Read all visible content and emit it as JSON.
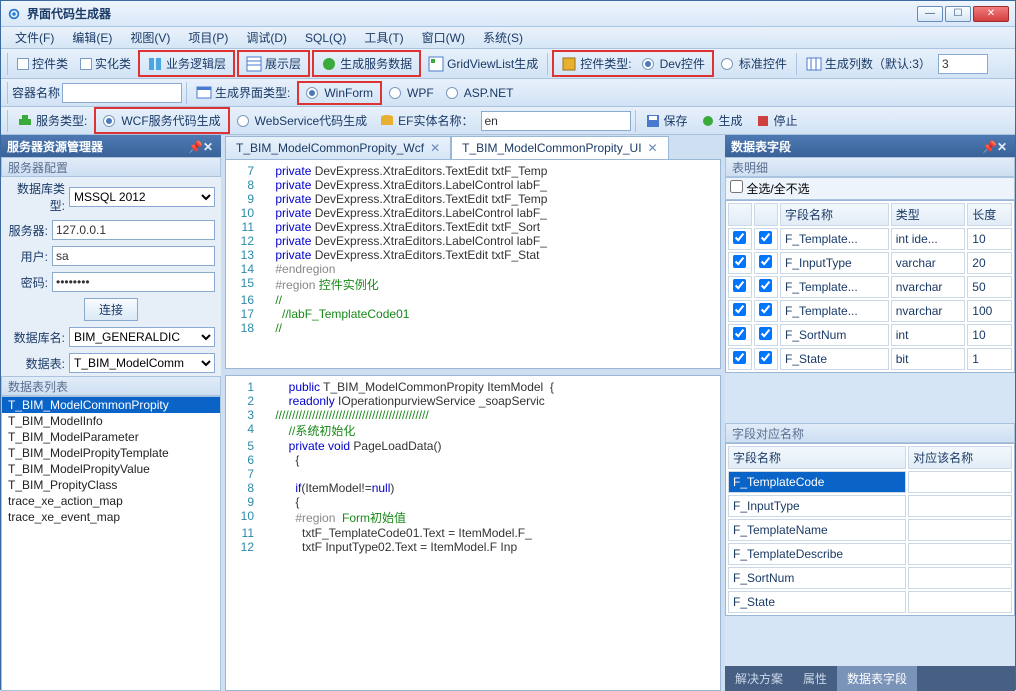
{
  "window": {
    "title": "界面代码生成器"
  },
  "menu": [
    "文件(F)",
    "编辑(E)",
    "视图(V)",
    "项目(P)",
    "调试(D)",
    "SQL(Q)",
    "工具(T)",
    "窗口(W)",
    "系统(S)"
  ],
  "toolbar1": {
    "ctrl_class": "控件类",
    "impl_class": "实化类",
    "biz_layer": "业务逻辑层",
    "view_layer": "展示层",
    "gen_data": "生成服务数据",
    "gridview": "GridViewList生成",
    "ctrl_type_lbl": "控件类型:",
    "dev_ctrl": "Dev控件",
    "std_ctrl": "标准控件",
    "gen_cols_lbl": "生成列数（默认:3）",
    "gen_cols_val": "3"
  },
  "toolbar2": {
    "container_lbl": "容器名称",
    "container_val": "",
    "gen_ui_type_lbl": "生成界面类型:",
    "winform": "WinForm",
    "wpf": "WPF",
    "aspnet": "ASP.NET"
  },
  "toolbar3": {
    "svc_type_lbl": "服务类型:",
    "wcf": "WCF服务代码生成",
    "webservice": "WebService代码生成",
    "ef_entity_lbl": "EF实体名称：",
    "ef_entity_val": "en",
    "save": "保存",
    "gen": "生成",
    "stop": "停止"
  },
  "left": {
    "title": "服务器资源管理器",
    "cfg_cap": "服务器配置",
    "db_type_lbl": "数据库类型:",
    "db_type_val": "MSSQL 2012",
    "server_lbl": "服务器:",
    "server_val": "127.0.0.1",
    "user_lbl": "用户:",
    "user_val": "sa",
    "pwd_lbl": "密码:",
    "pwd_val": "••••••••",
    "connect": "连接",
    "db_name_lbl": "数据库名:",
    "db_name_val": "BIM_GENERALDIC",
    "tbl_lbl": "数据表:",
    "tbl_val": "T_BIM_ModelComm",
    "list_cap": "数据表列表",
    "tables": [
      "T_BIM_ModelCommonPropity",
      "T_BIM_ModelInfo",
      "T_BIM_ModelParameter",
      "T_BIM_ModelPropityTemplate",
      "T_BIM_ModelPropityValue",
      "T_BIM_PropityClass",
      "trace_xe_action_map",
      "trace_xe_event_map"
    ]
  },
  "center": {
    "tab1": "T_BIM_ModelCommonPropity_Wcf",
    "tab2": "T_BIM_ModelCommonPropity_UI",
    "code1": [
      {
        "n": 7,
        "h": "<span class='kw'>private</span> DevExpress.XtraEditors.TextEdit txtF_Temp"
      },
      {
        "n": 8,
        "h": "<span class='kw'>private</span> DevExpress.XtraEditors.LabelControl labF_"
      },
      {
        "n": 9,
        "h": "<span class='kw'>private</span> DevExpress.XtraEditors.TextEdit txtF_Temp"
      },
      {
        "n": 10,
        "h": "<span class='kw'>private</span> DevExpress.XtraEditors.LabelControl labF_"
      },
      {
        "n": 11,
        "h": "<span class='kw'>private</span> DevExpress.XtraEditors.TextEdit txtF_Sort"
      },
      {
        "n": 12,
        "h": "<span class='kw'>private</span> DevExpress.XtraEditors.LabelControl labF_"
      },
      {
        "n": 13,
        "h": "<span class='kw'>private</span> DevExpress.XtraEditors.TextEdit txtF_Stat"
      },
      {
        "n": 14,
        "h": "<span class='region'>#endregion</span>"
      },
      {
        "n": 15,
        "h": "<span class='region'>#region</span> <span class='comment'>控件实例化</span>"
      },
      {
        "n": 16,
        "h": "<span class='comment'>//</span>"
      },
      {
        "n": 17,
        "h": "  <span class='comment'>//labF_TemplateCode01</span>"
      },
      {
        "n": 18,
        "h": "<span class='comment'>//</span>"
      }
    ],
    "code2": [
      {
        "n": 1,
        "h": "    <span class='kw'>public</span> T_BIM_ModelCommonPropity ItemModel  {"
      },
      {
        "n": 2,
        "h": "    <span class='kw'>readonly</span> IOperationpurviewService _soapServic"
      },
      {
        "n": 3,
        "h": "<span class='comment'>//////////////////////////////////////////////</span>"
      },
      {
        "n": 4,
        "h": "    <span class='comment'>//系统初始化</span>"
      },
      {
        "n": 5,
        "h": "    <span class='kw'>private</span> <span class='kw'>void</span> PageLoadData()"
      },
      {
        "n": 6,
        "h": "      {"
      },
      {
        "n": 7,
        "h": ""
      },
      {
        "n": 8,
        "h": "      <span class='kw'>if</span>(ItemModel!=<span class='kw'>null</span>)"
      },
      {
        "n": 9,
        "h": "      {"
      },
      {
        "n": 10,
        "h": "      <span class='region'>#region</span>  <span class='comment'>Form初始值</span>"
      },
      {
        "n": 11,
        "h": "        txtF_TemplateCode01.Text = ItemModel.F_"
      },
      {
        "n": 12,
        "h": "        txtF InputType02.Text = ItemModel.F Inp"
      }
    ]
  },
  "right": {
    "title": "数据表字段",
    "detail_cap": "表明细",
    "select_all": "全选/全不选",
    "cols": {
      "name": "字段名称",
      "type": "类型",
      "len": "长度"
    },
    "rows": [
      {
        "name": "F_Template...",
        "type": "int ide...",
        "len": "10"
      },
      {
        "name": "F_InputType",
        "type": "varchar",
        "len": "20"
      },
      {
        "name": "F_Template...",
        "type": "nvarchar",
        "len": "50"
      },
      {
        "name": "F_Template...",
        "type": "nvarchar",
        "len": "100"
      },
      {
        "name": "F_SortNum",
        "type": "int",
        "len": "10"
      },
      {
        "name": "F_State",
        "type": "bit",
        "len": "1"
      }
    ],
    "map_cap": "字段对应名称",
    "map_cols": {
      "field": "字段名称",
      "name": "对应该名称"
    },
    "map_rows": [
      "F_TemplateCode",
      "F_InputType",
      "F_TemplateName",
      "F_TemplateDescribe",
      "F_SortNum",
      "F_State"
    ],
    "btab1": "解决方案",
    "btab2": "属性",
    "btab3": "数据表字段"
  }
}
